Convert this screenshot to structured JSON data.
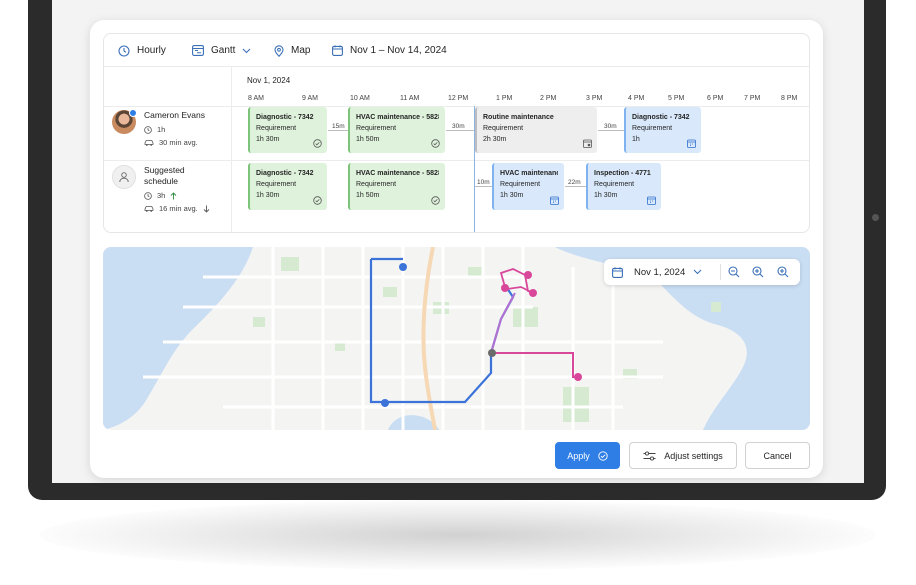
{
  "toolbar": {
    "view_mode": "Hourly",
    "layout": "Gantt",
    "map_label": "Map",
    "date_range": "Nov 1 – Nov 14, 2024"
  },
  "timeline": {
    "date": "Nov 1, 2024",
    "hours": [
      "8 AM",
      "9 AM",
      "10 AM",
      "11 AM",
      "12 PM",
      "1 PM",
      "2 PM",
      "3 PM",
      "4 PM",
      "5 PM",
      "6 PM",
      "7 PM",
      "8 PM"
    ]
  },
  "rows": [
    {
      "name": "Cameron Evans",
      "duration": "1h",
      "travel": "30 min avg.",
      "tasks": [
        {
          "title": "Diagnostic - 7342",
          "sub": "Requirement",
          "dur": "1h 30m",
          "status": "done"
        },
        {
          "title": "HVAC maintenance - 5828",
          "sub": "Requirement",
          "dur": "1h 50m",
          "status": "done"
        },
        {
          "title": "Routine maintenance",
          "sub": "Requirement",
          "dur": "2h 30m",
          "status": "pending"
        },
        {
          "title": "Diagnostic - 7342",
          "sub": "Requirement",
          "dur": "1h",
          "status": "scheduled"
        }
      ],
      "gaps": [
        "15m",
        "30m",
        "30m"
      ]
    },
    {
      "name": "Suggested schedule",
      "duration": "3h",
      "travel": "16 min avg.",
      "tasks": [
        {
          "title": "Diagnostic - 7342",
          "sub": "Requirement",
          "dur": "1h 30m",
          "status": "done"
        },
        {
          "title": "HVAC maintenance - 5828",
          "sub": "Requirement",
          "dur": "1h 50m",
          "status": "done"
        },
        {
          "title": "HVAC maintenance",
          "sub": "Requirement",
          "dur": "1h 30m",
          "status": "scheduled"
        },
        {
          "title": "Inspection - 4771",
          "sub": "Requirement",
          "dur": "1h 30m",
          "status": "scheduled"
        }
      ],
      "gaps": [
        "10m",
        "22m"
      ]
    }
  ],
  "map": {
    "date": "Nov 1, 2024",
    "colors": {
      "route_blue": "#3b73d9",
      "route_pink": "#d9479b",
      "route_purple": "#b36fd1",
      "water": "#c9ddf3",
      "park": "#d6ead1"
    }
  },
  "actions": {
    "apply": "Apply",
    "adjust": "Adjust settings",
    "cancel": "Cancel"
  }
}
